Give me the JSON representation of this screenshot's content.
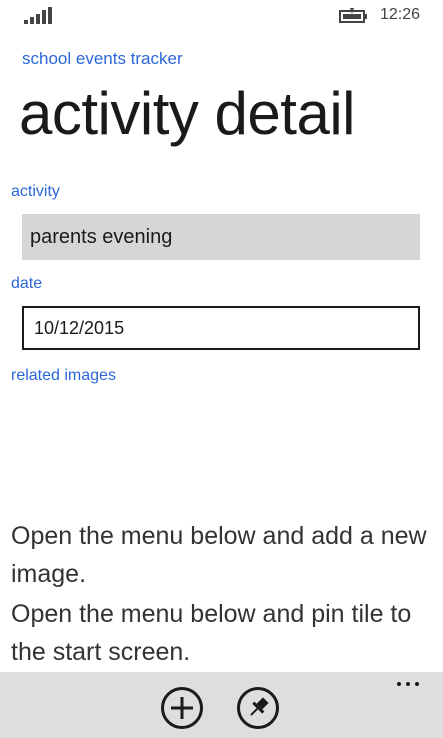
{
  "status_bar": {
    "time": "12:26",
    "signal_icon": "signal-icon",
    "battery_icon": "battery-icon"
  },
  "header": {
    "app_name": "school events tracker",
    "page_title": "activity detail"
  },
  "form": {
    "activity_label": "activity",
    "activity_value": "parents evening",
    "date_label": "date",
    "date_value": "10/12/2015",
    "images_label": "related images"
  },
  "hints": {
    "add_image": "Open the menu below and add a new image.",
    "pin_tile": "Open the menu below and pin tile to the start screen."
  },
  "app_bar": {
    "add_icon": "add-icon",
    "pin_icon": "pin-icon",
    "more_icon": "more-icon"
  }
}
